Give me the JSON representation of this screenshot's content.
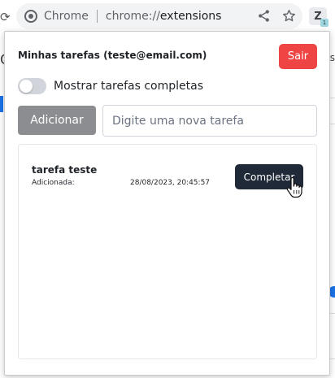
{
  "browser": {
    "chip_label": "Chrome",
    "url_scheme": "chrome://",
    "url_host": "extensions",
    "extension_badge": "1"
  },
  "popup": {
    "user_title": "Minhas tarefas (teste@email.com)",
    "logout_label": "Sair",
    "toggle_label": "Mostrar tarefas completas",
    "show_completed": false,
    "add_label": "Adicionar",
    "input_placeholder": "Digite uma nova tarefa",
    "input_value": "",
    "tasks": [
      {
        "name": "tarefa teste",
        "added_label": "Adicionada:",
        "date": "28/08/2023, 20:45:57",
        "complete_label": "Completar"
      }
    ]
  },
  "colors": {
    "logout": "#ef4444",
    "add_button": "#8b8d91",
    "complete_button": "#1f2937",
    "toggle_off": "#d1d5db"
  },
  "icons": [
    "site-info-icon",
    "share-icon",
    "star-icon",
    "extension-icon",
    "hand-cursor-icon"
  ]
}
